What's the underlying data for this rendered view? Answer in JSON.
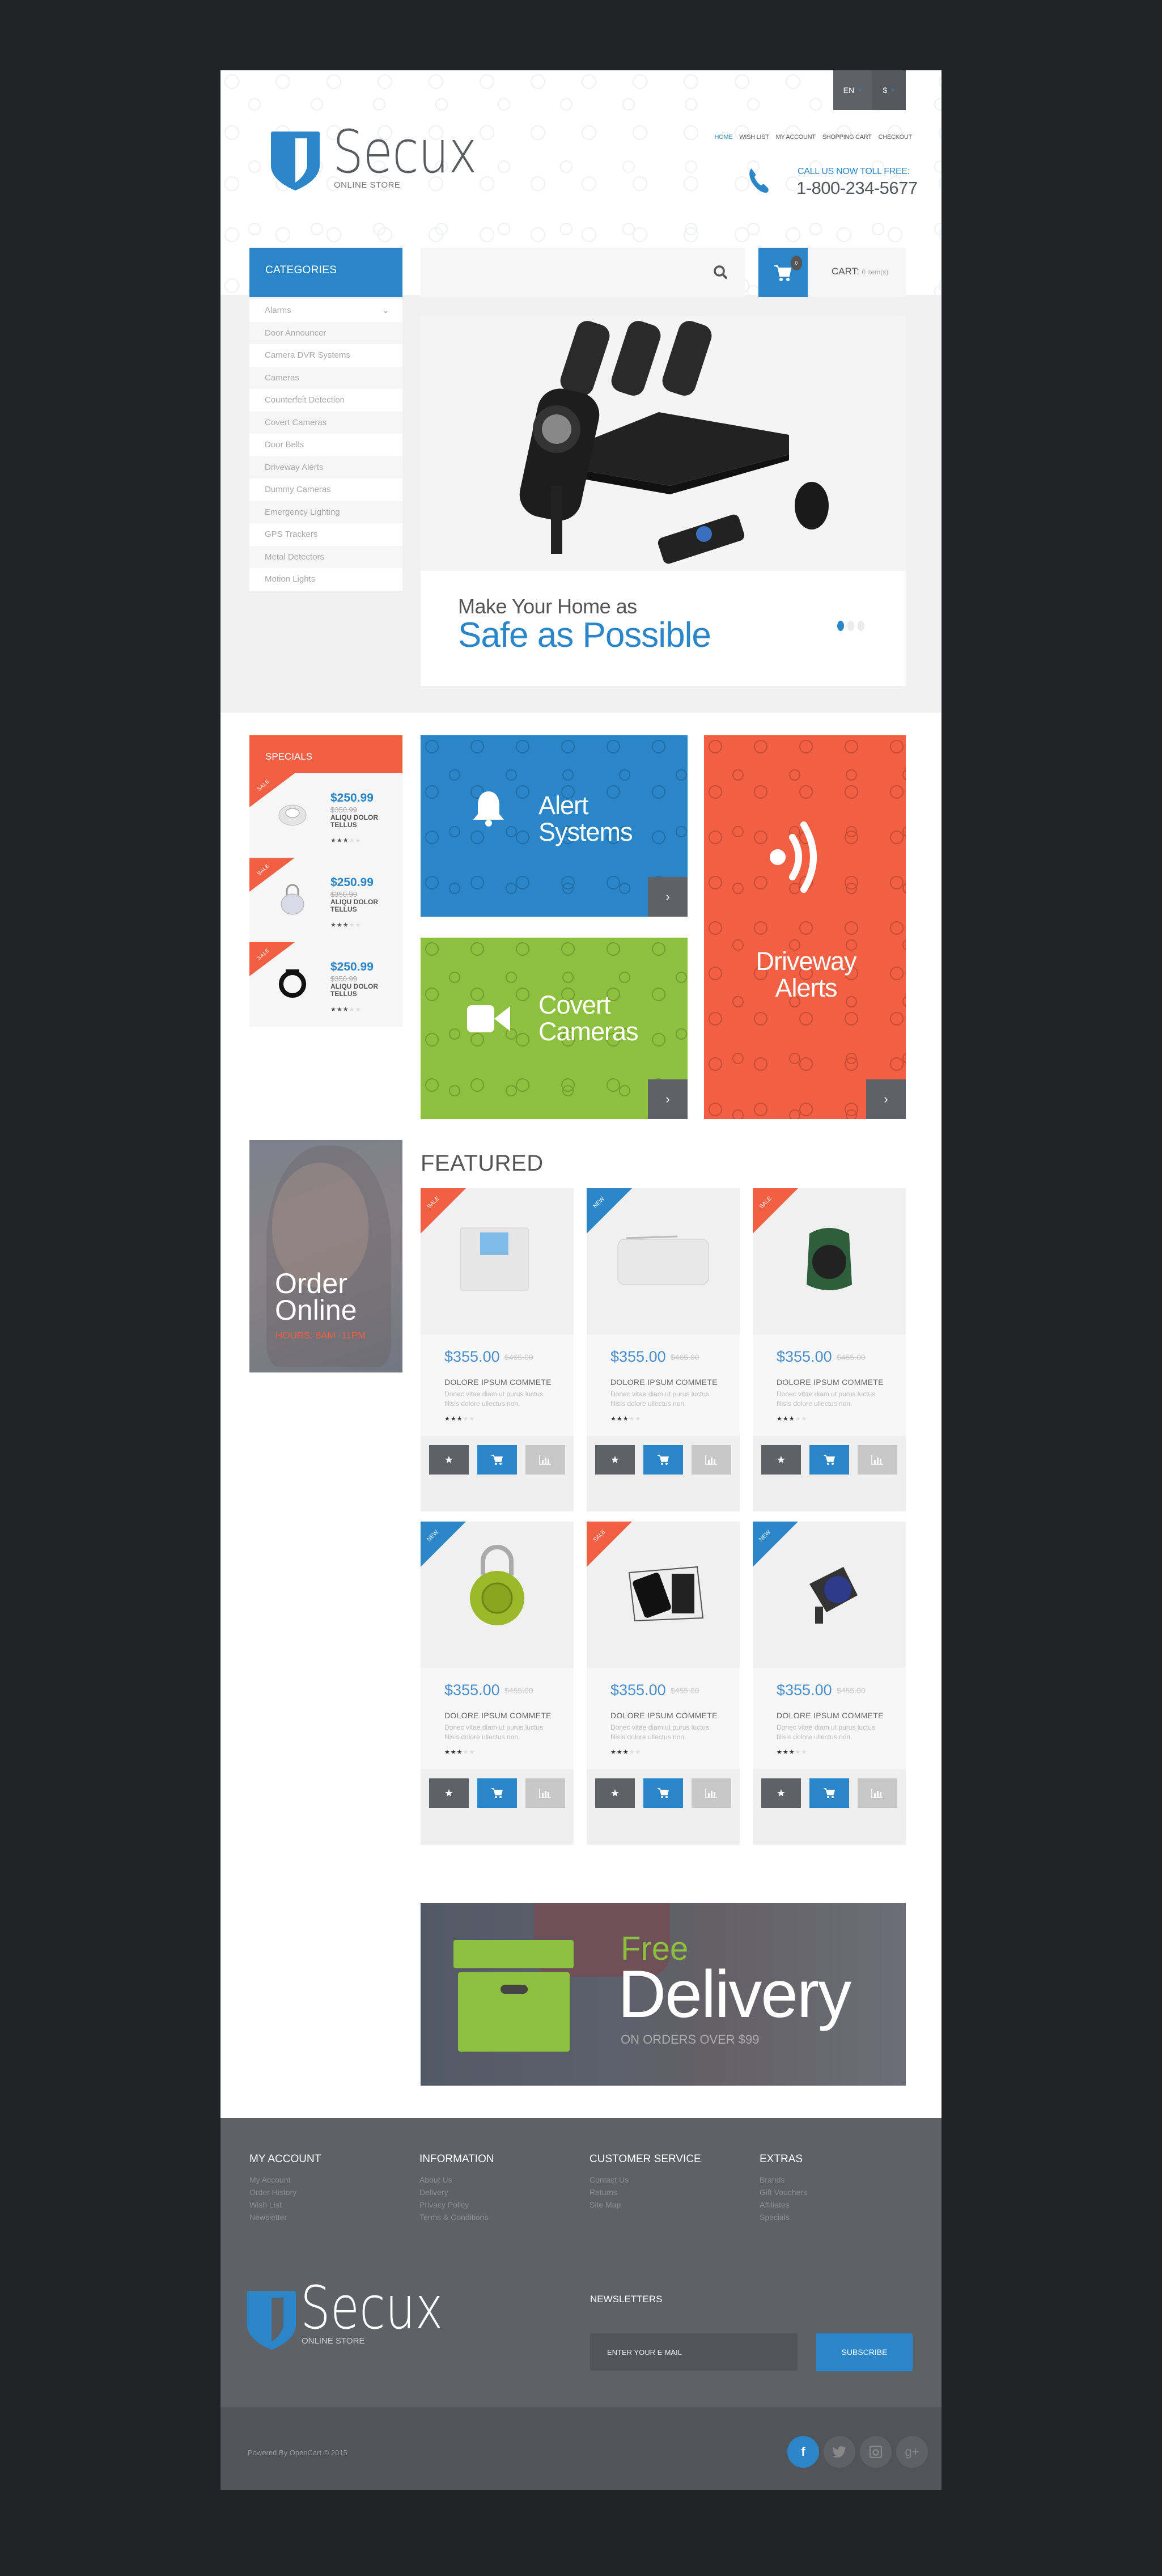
{
  "header": {
    "language": "EN",
    "currency": "$",
    "logo_name": "Secux",
    "logo_sub": "ONLINE STORE",
    "nav": [
      {
        "label": "HOME",
        "active": true
      },
      {
        "label": "WISH LIST",
        "active": false
      },
      {
        "label": "MY ACCOUNT",
        "active": false
      },
      {
        "label": "SHOPPING CART",
        "active": false
      },
      {
        "label": "CHECKOUT",
        "active": false
      }
    ],
    "call_label": "CALL US NOW TOLL FREE:",
    "phone": "1-800-234-5677"
  },
  "categories": {
    "title": "CATEGORIES",
    "items": [
      "Alarms",
      "Door Announcer",
      "Camera DVR Systems",
      "Cameras",
      "Counterfeit Detection",
      "Covert Cameras",
      "Door Bells",
      "Driveway Alerts",
      "Dummy Cameras",
      "Emergency Lighting",
      "GPS Trackers",
      "Metal Detectors",
      "Motion Lights"
    ]
  },
  "search": {
    "placeholder": ""
  },
  "cart": {
    "label": "CART:",
    "count_text": "0 item(s)",
    "badge": "0"
  },
  "hero": {
    "line1": "Make Your Home as",
    "line2": "Safe as Possible",
    "slides": 3,
    "active_slide": 1
  },
  "specials": {
    "title": "SPECIALS",
    "items": [
      {
        "badge": "SALE",
        "price": "$250.99",
        "old_price": "$350.99",
        "name": "ALIQU DOLOR TELLUS",
        "rating": 3,
        "thumb": "smoke-detector"
      },
      {
        "badge": "SALE",
        "price": "$250.99",
        "old_price": "$350.99",
        "name": "ALIQU DOLOR TELLUS",
        "rating": 3,
        "thumb": "padlock"
      },
      {
        "badge": "SALE",
        "price": "$250.99",
        "old_price": "$350.99",
        "name": "ALIQU DOLOR TELLUS",
        "rating": 3,
        "thumb": "bike-lock"
      }
    ]
  },
  "tiles": {
    "alert": {
      "title_1": "Alert",
      "title_2": "Systems",
      "color": "#2a86c8"
    },
    "covert": {
      "title_1": "Covert",
      "title_2": "Cameras",
      "color": "#8dc03f"
    },
    "driveway": {
      "title_1": "Driveway",
      "title_2": "Alerts",
      "color": "#f25f43"
    }
  },
  "order_online": {
    "line1": "Order",
    "line2": "Online",
    "hours": "HOURS: 8AM -11PM"
  },
  "featured": {
    "title": "FEATURED",
    "products": [
      {
        "badge": "SALE",
        "price": "$355.00",
        "old_price": "$465.00",
        "name": "DOLORE IPSUM COMMETE",
        "desc": "Donec vitae diam ut purus luctus filisis dolore ullectus non.",
        "rating": 3
      },
      {
        "badge": "NEW",
        "price": "$355.00",
        "old_price": "$465.00",
        "name": "DOLORE IPSUM COMMETE",
        "desc": "Donec vitae diam ut purus luctus filisis dolore ullectus non.",
        "rating": 3
      },
      {
        "badge": "SALE",
        "price": "$355.00",
        "old_price": "$465.00",
        "name": "DOLORE IPSUM COMMETE",
        "desc": "Donec vitae diam ut purus luctus filisis dolore ullectus non.",
        "rating": 3
      },
      {
        "badge": "NEW",
        "price": "$355.00",
        "old_price": "$455.00",
        "name": "DOLORE IPSUM COMMETE",
        "desc": "Donec vitae diam ut purus luctus filisis dolore ullectus non.",
        "rating": 3
      },
      {
        "badge": "SALE",
        "price": "$355.00",
        "old_price": "$455.00",
        "name": "DOLORE IPSUM COMMETE",
        "desc": "Donec vitae diam ut purus luctus filisis dolore ullectus non.",
        "rating": 3
      },
      {
        "badge": "NEW",
        "price": "$355.00",
        "old_price": "$455.00",
        "name": "DOLORE IPSUM COMMETE",
        "desc": "Donec vitae diam ut purus luctus filisis dolore ullectus non.",
        "rating": 3
      }
    ]
  },
  "delivery": {
    "free": "Free",
    "title": "Delivery",
    "sub": "ON ORDERS OVER $99"
  },
  "footer": {
    "columns": [
      {
        "title": "MY ACCOUNT",
        "links": [
          "My Account",
          "Order History",
          "Wish List",
          "Newsletter"
        ]
      },
      {
        "title": "INFORMATION",
        "links": [
          "About Us",
          "Delivery",
          "Privacy Policy",
          "Terms & Conditions"
        ]
      },
      {
        "title": "CUSTOMER SERVICE",
        "links": [
          "Contact Us",
          "Returns",
          "Site Map"
        ]
      },
      {
        "title": "EXTRAS",
        "links": [
          "Brands",
          "Gift Vouchers",
          "Affiliates",
          "Specials"
        ]
      }
    ],
    "logo_name": "Secux",
    "logo_sub": "ONLINE STORE",
    "newsletter_title": "NEWSLETTERS",
    "newsletter_placeholder": "ENTER YOUR E-MAIL",
    "subscribe_label": "SUBSCRIBE",
    "powered": "Powered By OpenCart  © 2015",
    "social": [
      {
        "name": "facebook",
        "glyph": "f"
      },
      {
        "name": "twitter",
        "glyph": "🐦"
      },
      {
        "name": "instagram",
        "glyph": "◙"
      },
      {
        "name": "google-plus",
        "glyph": "g+"
      }
    ]
  },
  "colors": {
    "blue": "#2a86c8",
    "red": "#f25f43",
    "green": "#8dc03f",
    "dark": "#5e6166"
  }
}
